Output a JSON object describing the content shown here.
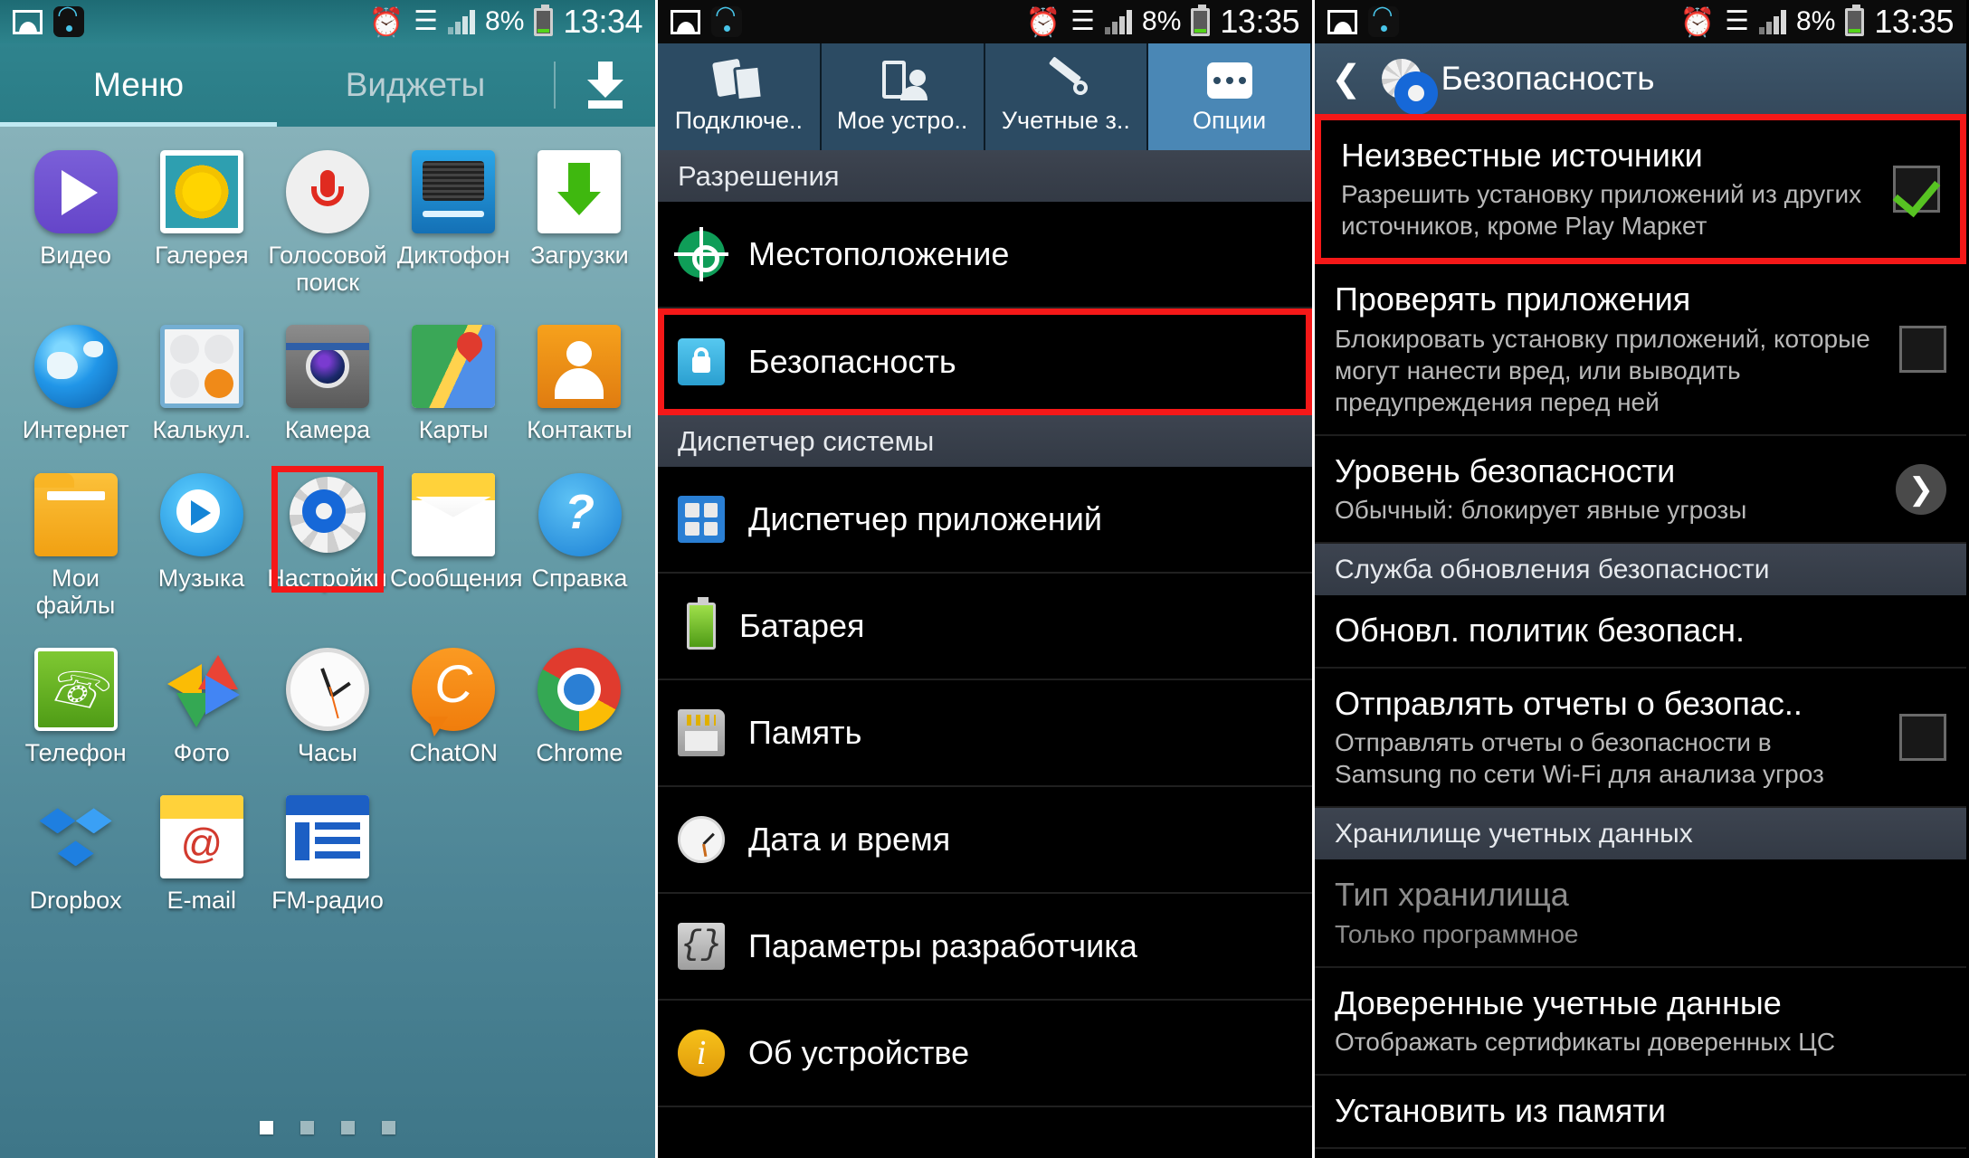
{
  "panel1": {
    "statusbar": {
      "left_icons": [
        "image-icon",
        "wifi-icon"
      ],
      "alarm": "alarm-icon",
      "wifi": "wifi-icon",
      "signal": "signal-bars-icon",
      "battery_pct": "8%",
      "time": "13:34"
    },
    "tabs": [
      {
        "label": "Меню",
        "active": true
      },
      {
        "label": "Виджеты",
        "active": false
      }
    ],
    "download_button": "download-icon",
    "apps": [
      [
        {
          "label": "Видео",
          "icon": "video-icon"
        },
        {
          "label": "Галерея",
          "icon": "gallery-icon"
        },
        {
          "label": "Голосовой поиск",
          "icon": "voice-search-icon"
        },
        {
          "label": "Диктофон",
          "icon": "voice-recorder-icon"
        },
        {
          "label": "Загрузки",
          "icon": "downloads-icon"
        }
      ],
      [
        {
          "label": "Интернет",
          "icon": "internet-icon"
        },
        {
          "label": "Калькул.",
          "icon": "calculator-icon"
        },
        {
          "label": "Камера",
          "icon": "camera-icon"
        },
        {
          "label": "Карты",
          "icon": "maps-icon"
        },
        {
          "label": "Контакты",
          "icon": "contacts-icon"
        }
      ],
      [
        {
          "label": "Мои файлы",
          "icon": "my-files-icon"
        },
        {
          "label": "Музыка",
          "icon": "music-icon"
        },
        {
          "label": "Настройки",
          "icon": "settings-icon",
          "highlighted": true
        },
        {
          "label": "Сообщения",
          "icon": "messages-icon"
        },
        {
          "label": "Справка",
          "icon": "help-icon"
        }
      ],
      [
        {
          "label": "Телефон",
          "icon": "phone-icon"
        },
        {
          "label": "Фото",
          "icon": "photos-icon"
        },
        {
          "label": "Часы",
          "icon": "clock-icon"
        },
        {
          "label": "ChatON",
          "icon": "chaton-icon"
        },
        {
          "label": "Chrome",
          "icon": "chrome-icon"
        }
      ],
      [
        {
          "label": "Dropbox",
          "icon": "dropbox-icon"
        },
        {
          "label": "E-mail",
          "icon": "email-icon"
        },
        {
          "label": "FM-радио",
          "icon": "fm-radio-icon"
        },
        {
          "label": "",
          "icon": ""
        },
        {
          "label": "",
          "icon": ""
        }
      ]
    ],
    "page_dots": {
      "count": 4,
      "active_index": 0
    }
  },
  "panel2": {
    "statusbar": {
      "battery_pct": "8%",
      "time": "13:35"
    },
    "tabs": [
      {
        "label": "Подключе..",
        "icon": "connections-icon",
        "active": false
      },
      {
        "label": "Мое устро..",
        "icon": "my-device-icon",
        "active": false
      },
      {
        "label": "Учетные з..",
        "icon": "accounts-icon",
        "active": false
      },
      {
        "label": "Опции",
        "icon": "more-options-icon",
        "active": true
      }
    ],
    "sections": [
      {
        "header": "Разрешения",
        "items": [
          {
            "label": "Местоположение",
            "icon": "location-icon",
            "highlighted": false
          },
          {
            "label": "Безопасность",
            "icon": "security-lock-icon",
            "highlighted": true
          }
        ]
      },
      {
        "header": "Диспетчер системы",
        "items": [
          {
            "label": "Диспетчер приложений",
            "icon": "application-manager-icon",
            "highlighted": false
          },
          {
            "label": "Батарея",
            "icon": "battery-icon",
            "highlighted": false
          },
          {
            "label": "Память",
            "icon": "storage-icon",
            "highlighted": false
          },
          {
            "label": "Дата и время",
            "icon": "date-time-icon",
            "highlighted": false
          },
          {
            "label": "Параметры разработчика",
            "icon": "developer-options-icon",
            "highlighted": false
          },
          {
            "label": "Об устройстве",
            "icon": "about-device-icon",
            "highlighted": false
          }
        ]
      }
    ]
  },
  "panel3": {
    "statusbar": {
      "battery_pct": "8%",
      "time": "13:35"
    },
    "appbar": {
      "back": "back-chevron-icon",
      "icon": "settings-gear-icon",
      "title": "Безопасность"
    },
    "rows": [
      {
        "type": "check",
        "title": "Неизвестные источники",
        "sub": "Разрешить установку приложений из других источников, кроме Play Маркет",
        "checked": true,
        "highlighted": true
      },
      {
        "type": "check",
        "title": "Проверять приложения",
        "sub": "Блокировать установку приложений, которые могут нанести вред, или выводить предупреждения перед ней",
        "checked": false,
        "highlighted": false
      },
      {
        "type": "arrow",
        "title": "Уровень безопасности",
        "sub": "Обычный: блокирует явные угрозы",
        "highlighted": false
      },
      {
        "type": "section",
        "title": "Служба обновления безопасности"
      },
      {
        "type": "plain",
        "title": "Обновл. политик безопасн.",
        "sub": "",
        "highlighted": false
      },
      {
        "type": "check",
        "title": "Отправлять отчеты о безопас..",
        "sub": "Отправлять отчеты о безопасности в Samsung по сети Wi-Fi для анализа угроз",
        "checked": false,
        "highlighted": false
      },
      {
        "type": "section",
        "title": "Хранилище учетных данных"
      },
      {
        "type": "plain",
        "title": "Тип хранилища",
        "sub": "Только программное",
        "dim": true
      },
      {
        "type": "plain",
        "title": "Доверенные учетные данные",
        "sub": "Отображать сертификаты доверенных ЦС",
        "highlighted": false
      },
      {
        "type": "plain",
        "title": "Установить из памяти",
        "sub": "",
        "highlighted": false
      }
    ]
  },
  "colors": {
    "highlight": "#f51818",
    "accent_teal": "#2d838c",
    "accent_blue": "#4a87b5",
    "check_green": "#57c322"
  }
}
